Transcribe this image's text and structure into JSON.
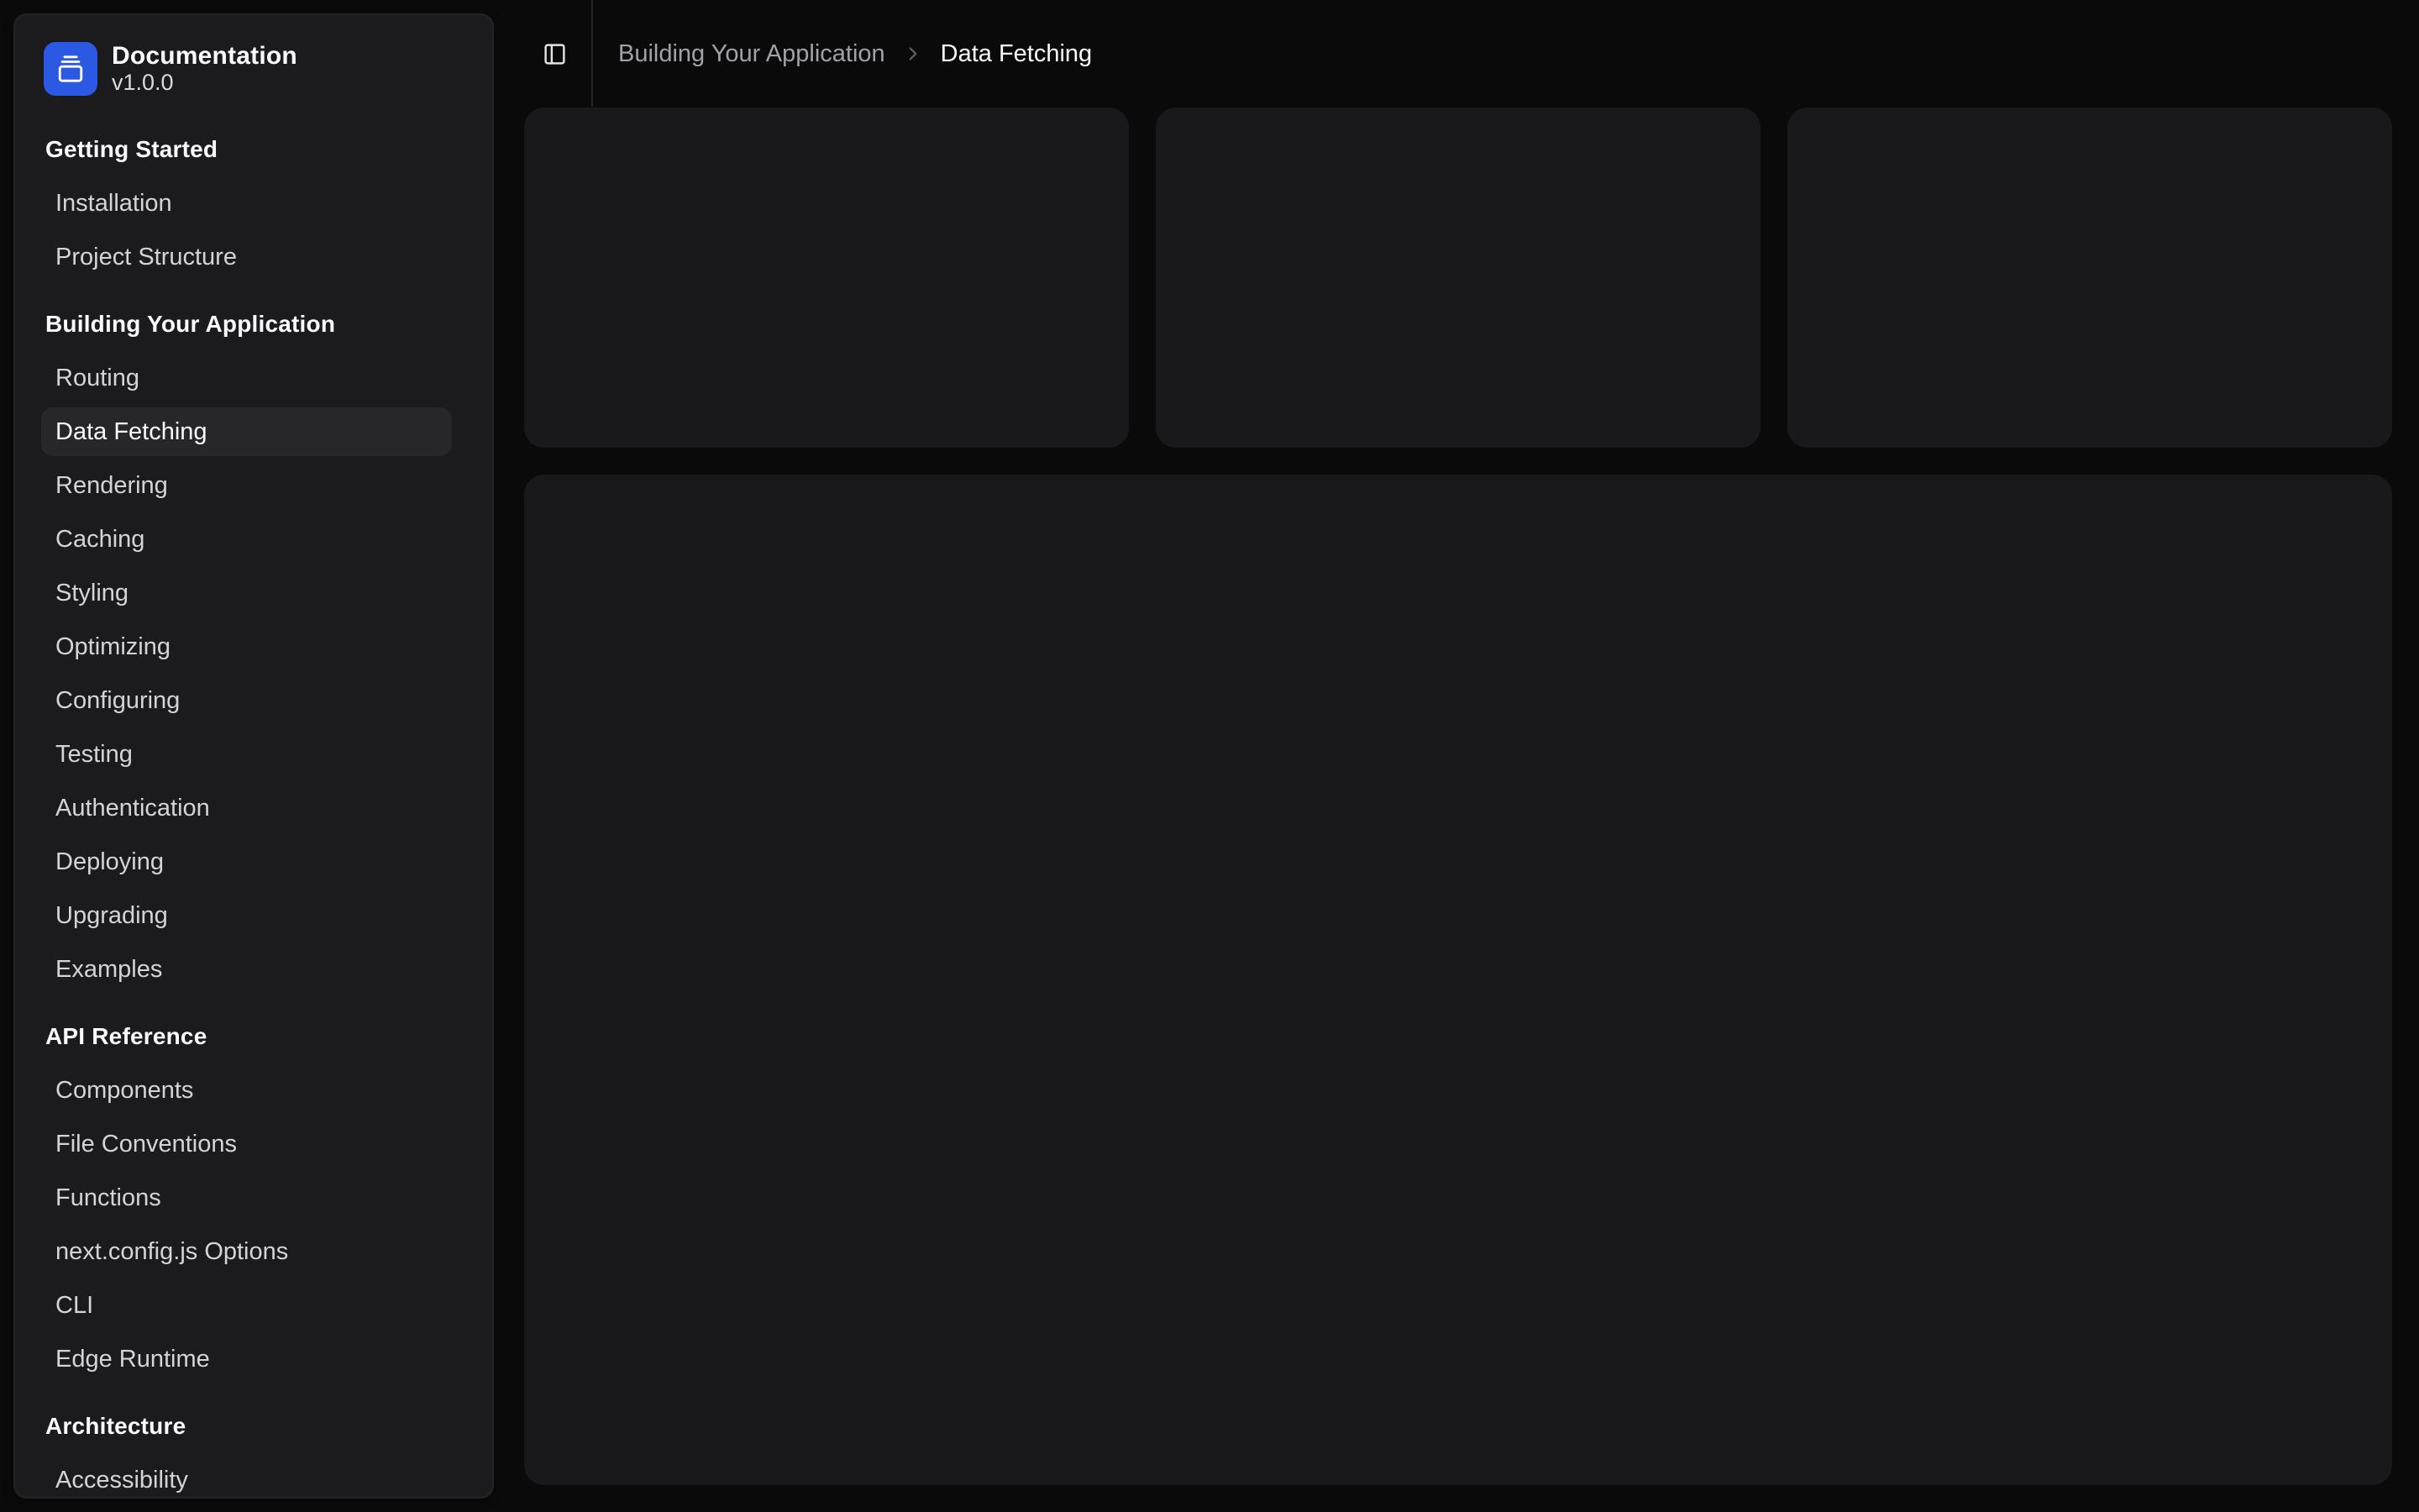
{
  "app": {
    "title": "Documentation",
    "version": "v1.0.0",
    "logo_icon": "gallery-vertical-end-icon"
  },
  "header": {
    "toggle_icon": "panel-left-icon",
    "breadcrumb": [
      {
        "label": "Building Your Application",
        "type": "link"
      },
      {
        "label": "Data Fetching",
        "type": "current"
      }
    ],
    "breadcrumb_separator_icon": "chevron-right-icon"
  },
  "sidebar": {
    "groups": [
      {
        "label": "Getting Started",
        "items": [
          {
            "label": "Installation",
            "active": false
          },
          {
            "label": "Project Structure",
            "active": false
          }
        ]
      },
      {
        "label": "Building Your Application",
        "items": [
          {
            "label": "Routing",
            "active": false
          },
          {
            "label": "Data Fetching",
            "active": true
          },
          {
            "label": "Rendering",
            "active": false
          },
          {
            "label": "Caching",
            "active": false
          },
          {
            "label": "Styling",
            "active": false
          },
          {
            "label": "Optimizing",
            "active": false
          },
          {
            "label": "Configuring",
            "active": false
          },
          {
            "label": "Testing",
            "active": false
          },
          {
            "label": "Authentication",
            "active": false
          },
          {
            "label": "Deploying",
            "active": false
          },
          {
            "label": "Upgrading",
            "active": false
          },
          {
            "label": "Examples",
            "active": false
          }
        ]
      },
      {
        "label": "API Reference",
        "items": [
          {
            "label": "Components",
            "active": false
          },
          {
            "label": "File Conventions",
            "active": false
          },
          {
            "label": "Functions",
            "active": false
          },
          {
            "label": "next.config.js Options",
            "active": false
          },
          {
            "label": "CLI",
            "active": false
          },
          {
            "label": "Edge Runtime",
            "active": false
          }
        ]
      },
      {
        "label": "Architecture",
        "items": [
          {
            "label": "Accessibility",
            "active": false
          }
        ]
      }
    ]
  },
  "content": {
    "top_placeholder_count": 3,
    "bottom_placeholder_count": 1
  },
  "colors": {
    "accent": "#2b59e3",
    "background": "#0a0a0b",
    "sidebar_background": "#1b1b1e",
    "card_background": "#19191c",
    "active_item_background": "#26262b",
    "muted_text": "#a1a1aa"
  }
}
